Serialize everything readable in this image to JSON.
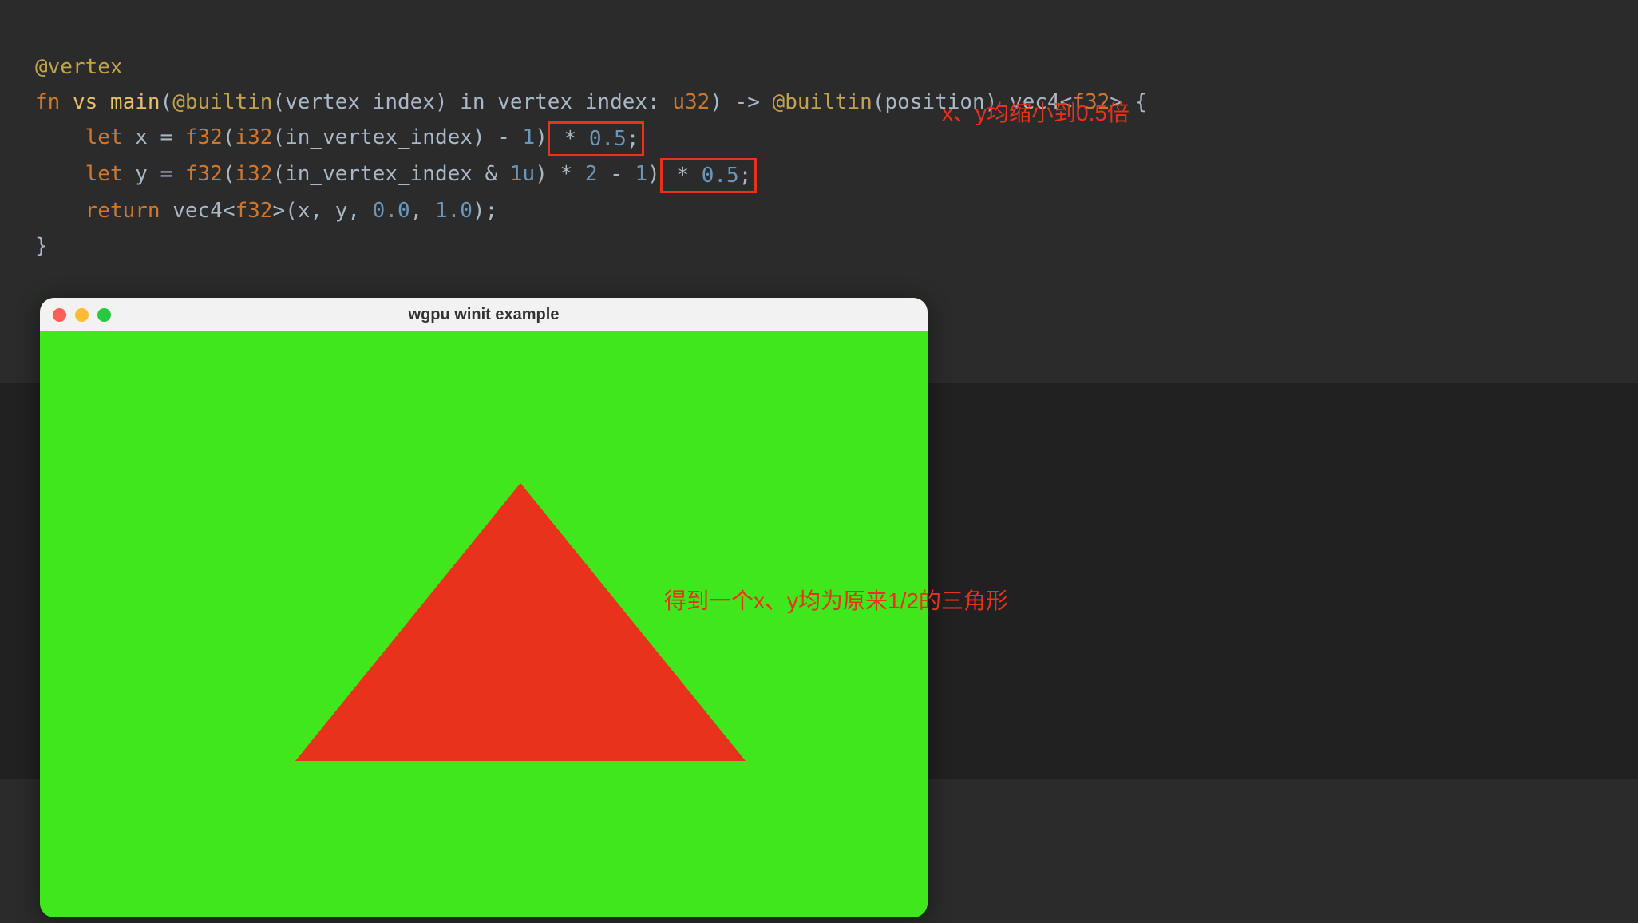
{
  "code": {
    "t_attr": "@vertex",
    "t_fn": "fn ",
    "t_name": "vs_main",
    "t_p1": "(",
    "t_builtin1": "@builtin",
    "t_p2": "(vertex_index) in_vertex_index: ",
    "t_u32": "u32",
    "t_p3": ") -> ",
    "t_builtin2": "@builtin",
    "t_p4": "(position) ",
    "t_vec4a": "vec4",
    "t_lt1": "<",
    "t_f32a": "f32",
    "t_gt1": "> {",
    "t_let1": "    let ",
    "t_x": "x = ",
    "t_f32b": "f32",
    "t_p5": "(",
    "t_i32a": "i32",
    "t_p6": "(in_vertex_index) - ",
    "t_n1": "1",
    "t_p7": ")",
    "t_hl1a": " * ",
    "t_hl1b": "0.5",
    "t_hl1c": ";",
    "t_let2": "    let ",
    "t_y": "y = ",
    "t_f32c": "f32",
    "t_p8": "(",
    "t_i32b": "i32",
    "t_p9": "(in_vertex_index & ",
    "t_n1u": "1u",
    "t_p10": ") * ",
    "t_n2": "2",
    "t_p11": " - ",
    "t_n1b": "1",
    "t_p12": ")",
    "t_hl2a": " * ",
    "t_hl2b": "0.5",
    "t_hl2c": ";",
    "t_ret": "    return ",
    "t_vec4b": "vec4",
    "t_lt2": "<",
    "t_f32d": "f32",
    "t_gt2": ">(x, y, ",
    "t_n0a": "0.0",
    "t_comma": ", ",
    "t_n1f": "1.0",
    "t_p13": ");",
    "t_close": "}"
  },
  "annotations": {
    "scale_note": "x、y均缩小到0.5倍",
    "triangle_note": "得到一个x、y均为原来1/2的三角形"
  },
  "window": {
    "title": "wgpu winit example"
  }
}
